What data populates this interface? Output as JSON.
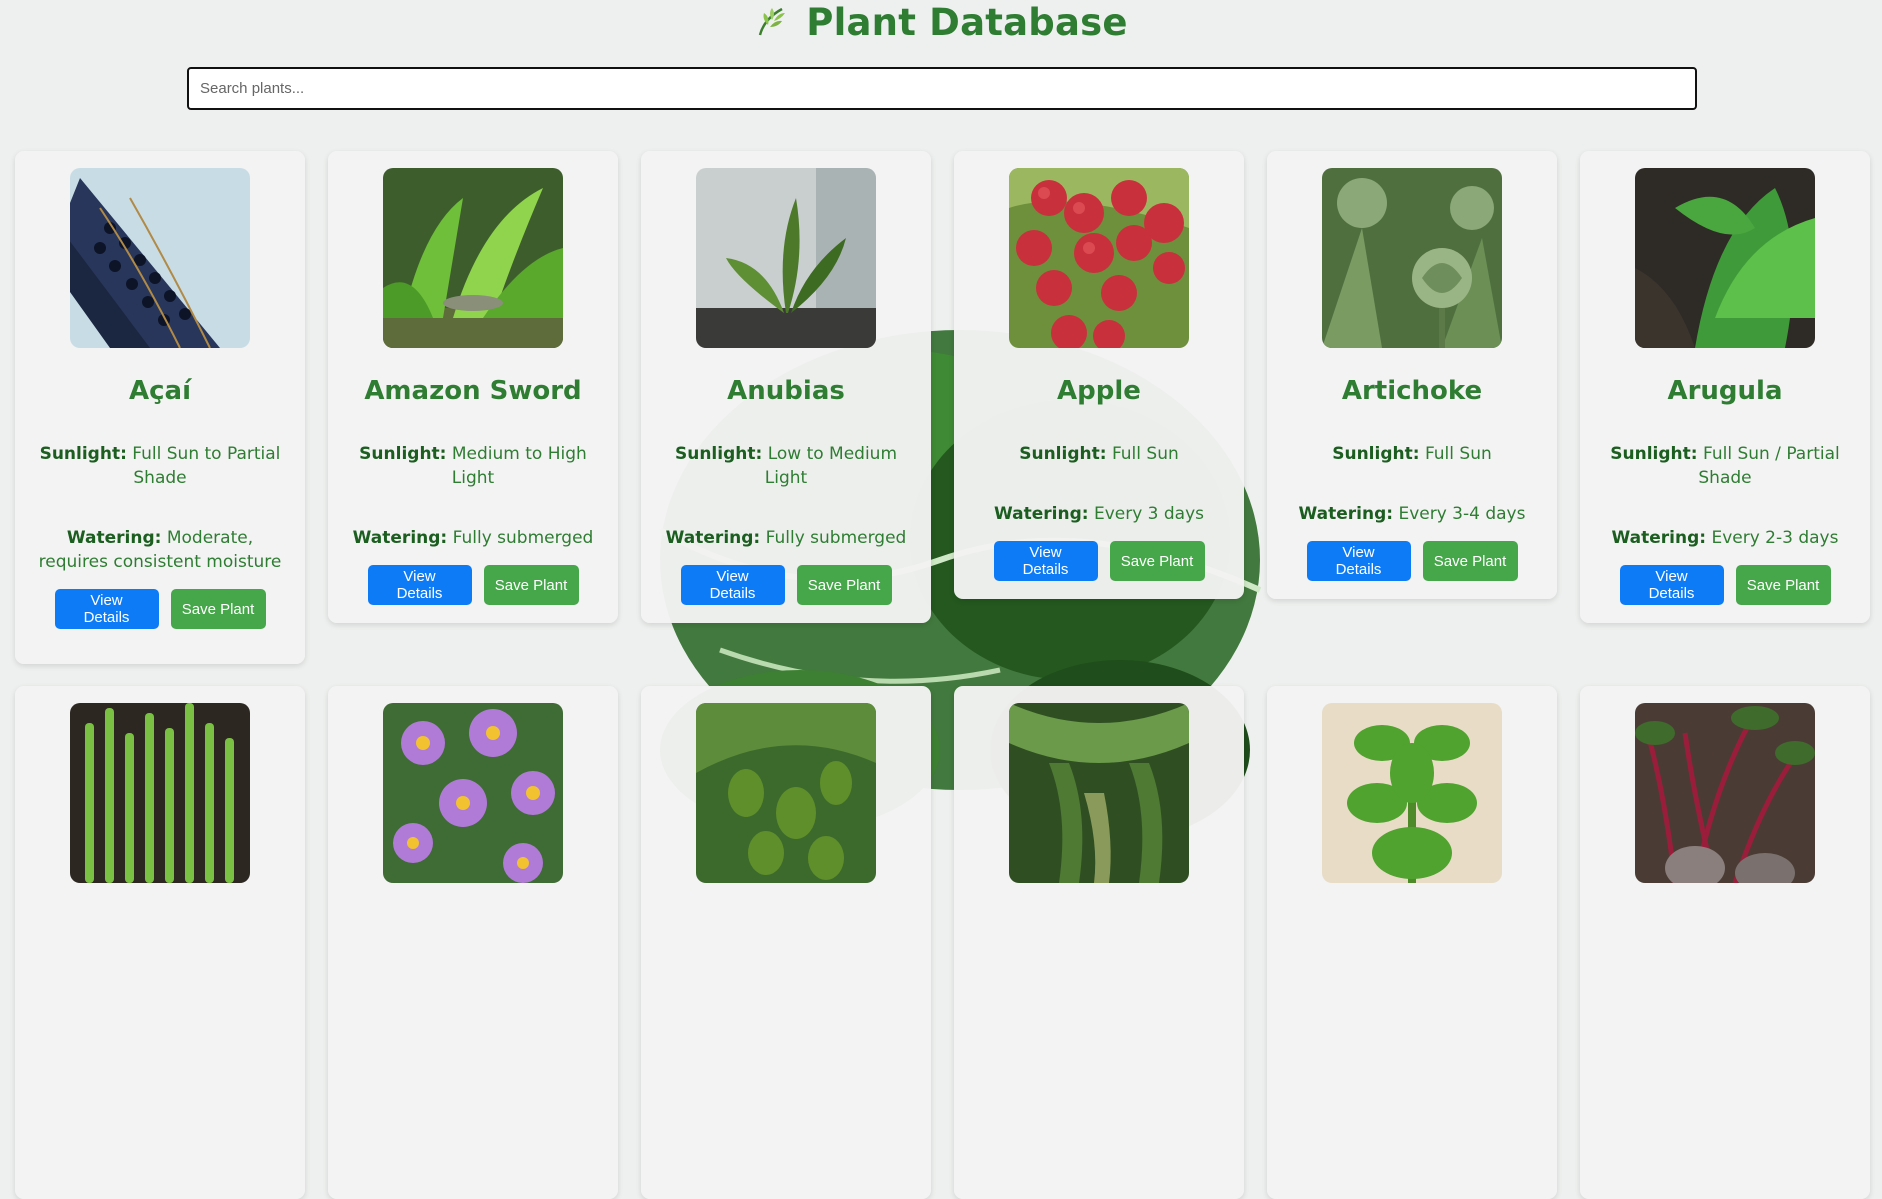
{
  "header": {
    "title": "Plant Database",
    "icon": "leaf-icon"
  },
  "search": {
    "placeholder": "Search plants...",
    "value": ""
  },
  "colors": {
    "title_green": "#2e7d32",
    "view_button": "#0d7bf6",
    "save_button": "#46a64a"
  },
  "labels": {
    "sunlight": "Sunlight:",
    "watering": "Watering:"
  },
  "buttons": {
    "view": "View Details",
    "save": "Save Plant"
  },
  "plants": [
    {
      "name": "Açaí",
      "sunlight": "Full Sun to Partial Shade",
      "watering": "Moderate, requires consistent moisture",
      "image": "acai-berries-photo"
    },
    {
      "name": "Amazon Sword",
      "sunlight": "Medium to High Light",
      "watering": "Fully submerged",
      "image": "amazon-sword-aquarium-photo"
    },
    {
      "name": "Anubias",
      "sunlight": "Low to Medium Light",
      "watering": "Fully submerged",
      "image": "anubias-tank-photo"
    },
    {
      "name": "Apple",
      "sunlight": "Full Sun",
      "watering": "Every 3 days",
      "image": "apples-on-branch-photo"
    },
    {
      "name": "Artichoke",
      "sunlight": "Full Sun",
      "watering": "Every 3-4 days",
      "image": "artichoke-plant-photo"
    },
    {
      "name": "Arugula",
      "sunlight": "Full Sun / Partial Shade",
      "watering": "Every 2-3 days",
      "image": "arugula-leaves-photo"
    },
    {
      "image": "asparagus-photo"
    },
    {
      "image": "aster-flowers-photo"
    },
    {
      "image": "avocado-tree-photo"
    },
    {
      "image": "banana-plant-photo"
    },
    {
      "image": "basil-plant-photo"
    },
    {
      "image": "beet-roots-photo"
    }
  ]
}
